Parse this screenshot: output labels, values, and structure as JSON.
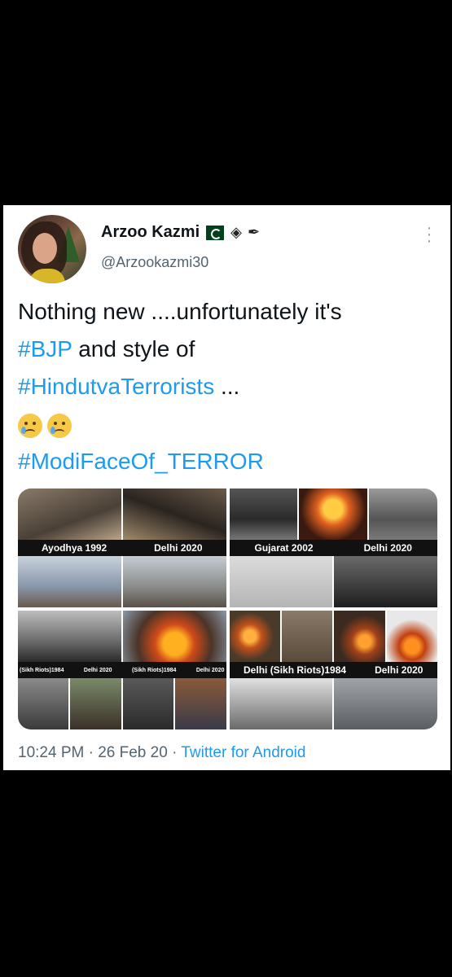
{
  "tweet": {
    "author_name": "Arzoo Kazmi",
    "author_badges": "◈ ✒",
    "author_handle": "@Arzookazmi30",
    "line1": "Nothing new ....unfortunately it's",
    "tag1": "#BJP",
    "line2_rest": " and style of",
    "tag2": "#HindutvaTerrorists",
    "line3_rest": " ...",
    "tag3": "#ModiFaceOf_TERROR",
    "emoji_name": "crying-face-icon"
  },
  "media": {
    "panel1": {
      "left": "Ayodhya 1992",
      "right": "Delhi 2020"
    },
    "panel2": {
      "left": "Gujarat 2002",
      "right": "Delhi 2020"
    },
    "panel3": {
      "a": "(Sikh Riots)1984",
      "b": "Delhi 2020",
      "c": "(Sikh Riots)1984",
      "d": "Delhi 2020"
    },
    "panel4": {
      "left": "Delhi (Sikh Riots)1984",
      "right": "Delhi 2020"
    }
  },
  "footer": {
    "time": "10:24 PM",
    "sep1": " · ",
    "date": "26 Feb 20",
    "sep2": " · ",
    "source": "Twitter for Android"
  },
  "colors": {
    "link": "#1d9bf0",
    "muted": "#536471",
    "background": "#000000"
  }
}
